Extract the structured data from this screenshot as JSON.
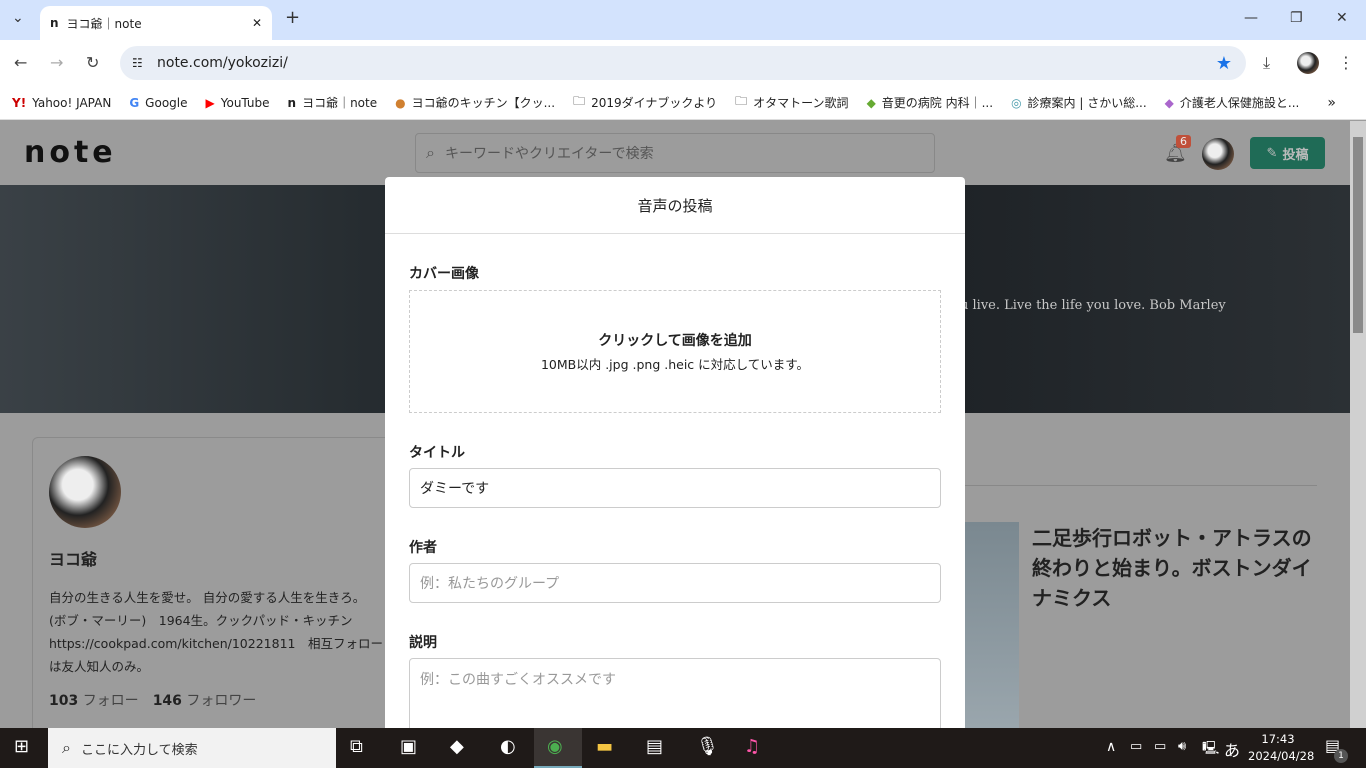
{
  "browser": {
    "tab_title": "ヨコ爺｜note",
    "url": "note.com/yokozizi/",
    "bookmarks": [
      "Yahoo! JAPAN",
      "Google",
      "YouTube",
      "ヨコ爺｜note",
      "ヨコ爺のキッチン【クッ...",
      "2019ダイナブックより",
      "オタマトーン歌詞",
      "音更の病院 内科｜...",
      "診療案内 | さかい総...",
      "介護老人保健施設と..."
    ]
  },
  "header": {
    "logo": "note",
    "search_placeholder": "キーワードやクリエイターで検索",
    "notification_count": "6",
    "post_label": "投稿"
  },
  "banner": {
    "quote": "u live. Live the life you love. Bob Marley"
  },
  "profile": {
    "name": "ヨコ爺",
    "bio_pre": "自分の生きる人生を愛せ。 自分の愛する人生を生きろ。 (ボブ・マーリー)　1964生。クックパッド・キッチン ",
    "bio_link": "https://cookpad.com/kitchen/10221811",
    "bio_post": "　相互フォローは友人知人のみ。",
    "follow_count": "103",
    "follow_label": "フォロー",
    "follower_count": "146",
    "follower_label": "フォロワー"
  },
  "article": {
    "title": "二足歩行ロボット・アトラスの終わりと始まり。ボストンダイナミクス"
  },
  "modal": {
    "title": "音声の投稿",
    "cover_label": "カバー画像",
    "cover_cta": "クリックして画像を追加",
    "cover_hint": "10MB以内 .jpg .png .heic に対応しています。",
    "title_label": "タイトル",
    "title_value": "ダミーです",
    "author_label": "作者",
    "author_placeholder": "例：私たちのグループ",
    "desc_label": "説明",
    "desc_placeholder": "例：この曲すごくオススメです"
  },
  "taskbar": {
    "search_placeholder": "ここに入力して検索",
    "time": "17:43",
    "date": "2024/04/28",
    "ime": "あ",
    "notifications": "1"
  },
  "colors": {
    "accent": "#1f6b56",
    "badge": "#c0503a"
  }
}
